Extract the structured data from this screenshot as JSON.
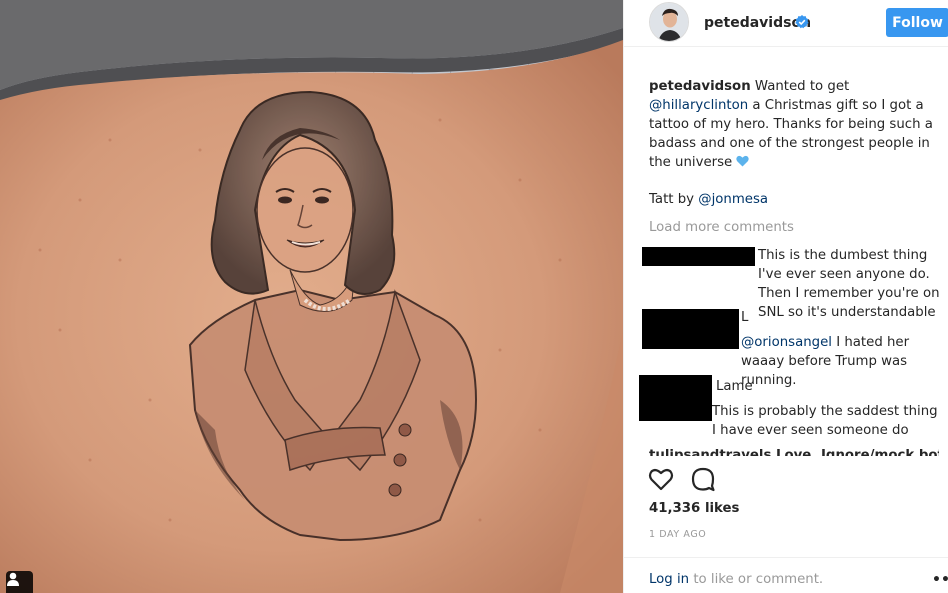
{
  "header": {
    "username": "petedavidson",
    "follow_label": "Follow"
  },
  "caption": {
    "user": "petedavidson",
    "text_1": " Wanted to get ",
    "mention": "@hillaryclinton",
    "text_2": " a Christmas gift so I got a tattoo of my hero. Thanks for being such a badass and one of the strongest people in the universe ",
    "heart_icon": "blue-heart-emoji",
    "tatt_prefix": "Tatt by ",
    "tatt_mention": "@jonmesa"
  },
  "load_more": "Load more comments",
  "comments": [
    {
      "text": "This is the dumbest thing I've ever seen anyone do. Then I remember you're on SNL so it's understandable"
    },
    {
      "suffix": "L",
      "mention": "@orionsangel",
      "text": " I hated her waaay before Trump was running."
    },
    {
      "text": "Lame"
    },
    {
      "text": "This is probably the saddest thing I have ever seen someone do"
    },
    {
      "text": "tulipsandtravels Love. Ignore/mock bots"
    }
  ],
  "actions": {
    "like_icon": "heart-outline-icon",
    "comment_icon": "speech-bubble-icon"
  },
  "likes": "41,336 likes",
  "time": "1 DAY AGO",
  "footer": {
    "login_label": "Log in",
    "login_suffix": " to like or comment.",
    "more_label": "•••"
  },
  "colors": {
    "follow_blue": "#3897f0",
    "link_blue": "#003569",
    "muted_gray": "#999999",
    "verified_blue": "#3897f0"
  }
}
